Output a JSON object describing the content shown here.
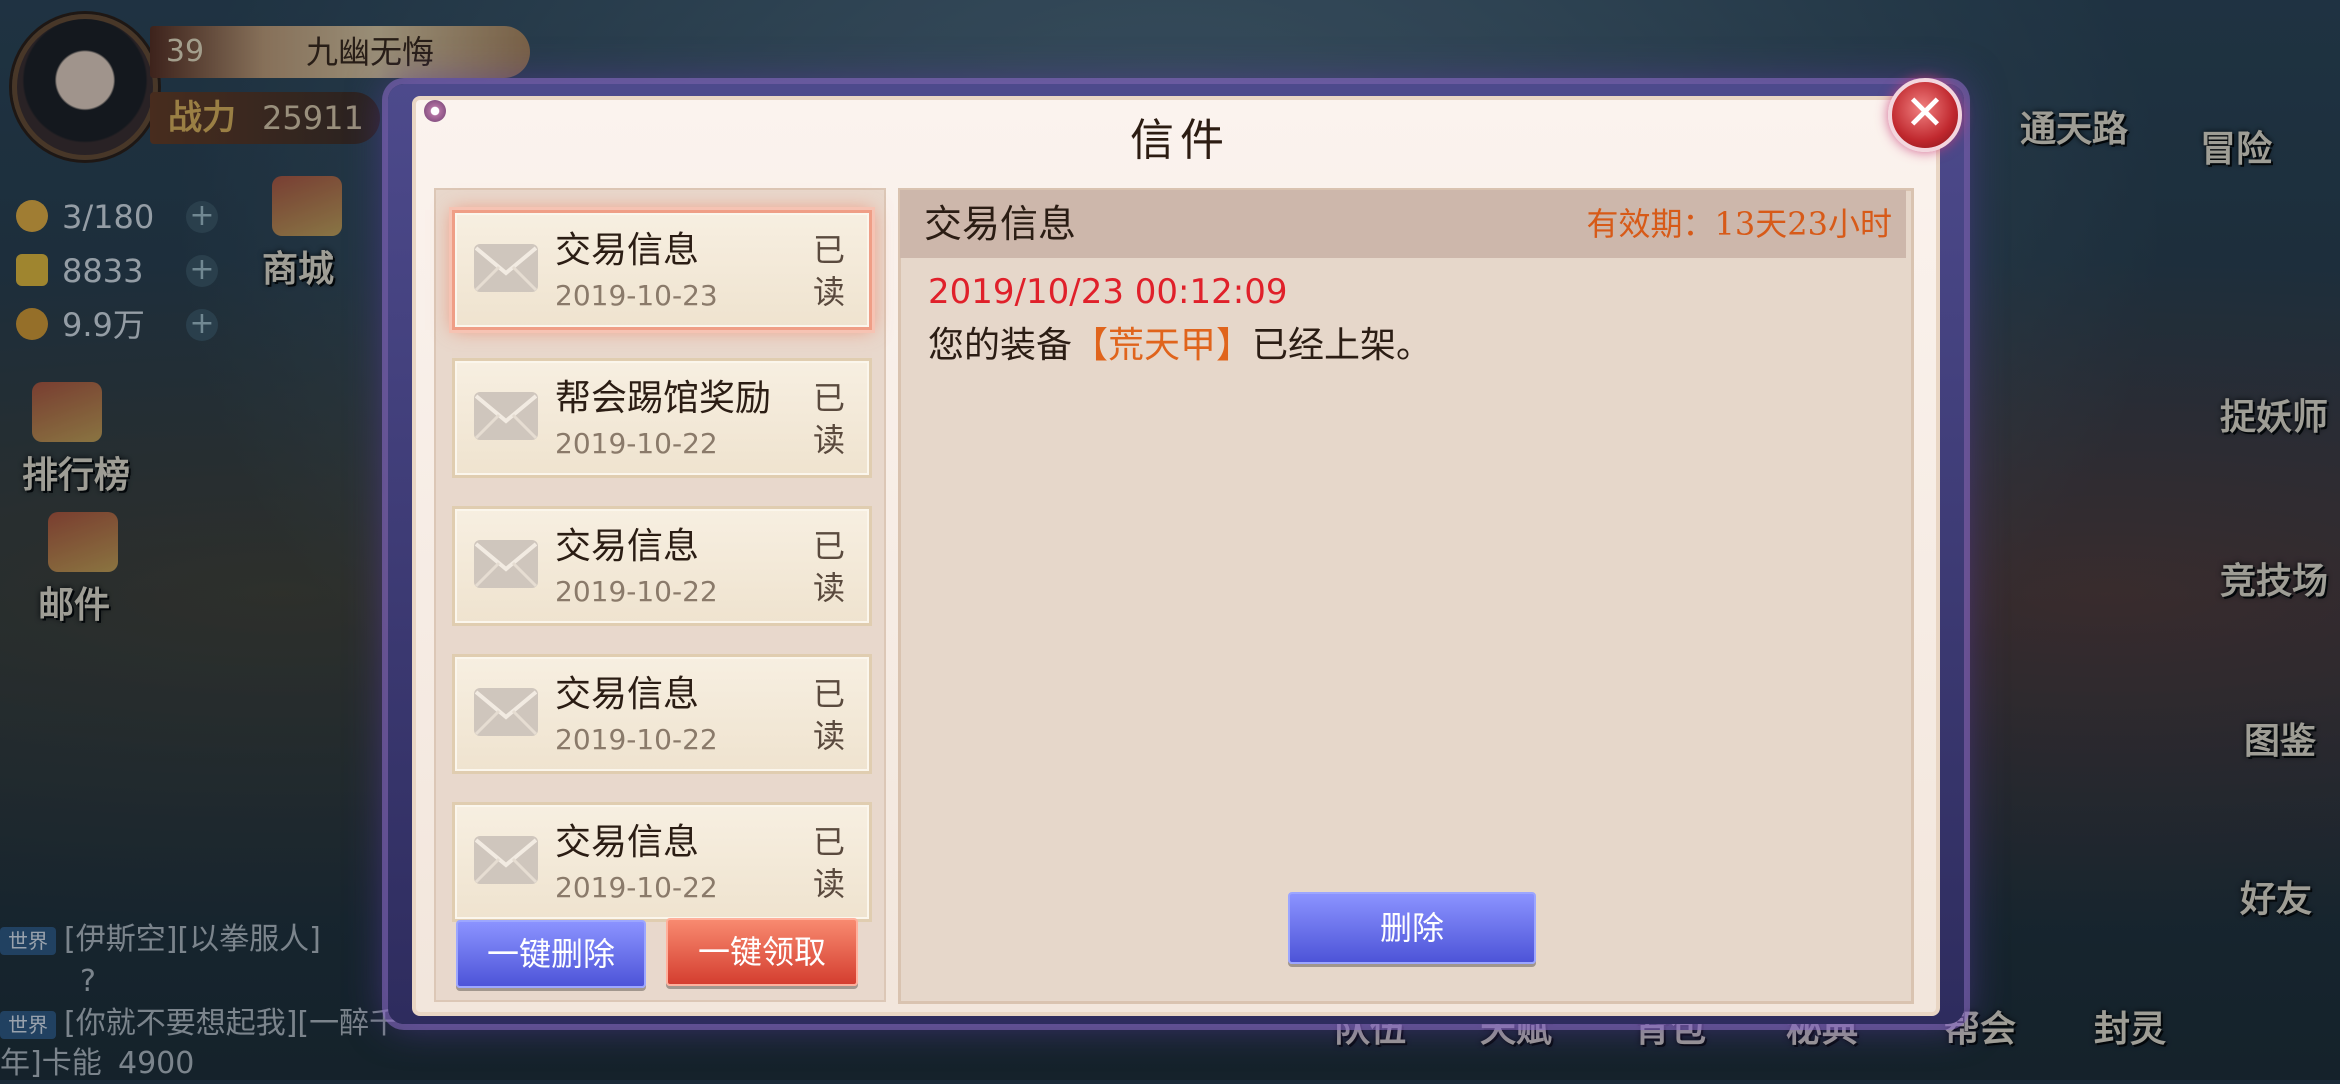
{
  "player": {
    "level": "39",
    "name": "九幽无悔",
    "power_label": "战力",
    "power_value": "25911"
  },
  "resources": [
    {
      "icon": "lightning-icon",
      "value": "3/180",
      "color": "#f2b640"
    },
    {
      "icon": "gold-ingot-icon",
      "value": "8833",
      "color": "#f0c23a"
    },
    {
      "icon": "coin-icon",
      "value": "9.9万",
      "color": "#e0a030"
    }
  ],
  "left_menu": {
    "shop": "商城",
    "ranking": "排行榜",
    "mail": "邮件"
  },
  "chat": [
    {
      "channel": "世界",
      "text": "[伊斯空][以拳服人]"
    },
    {
      "channel": "",
      "text": "?"
    },
    {
      "channel": "世界",
      "text": "[你就不要想起我][一醉千年]卡能"
    },
    {
      "channel": "",
      "text": "4900"
    }
  ],
  "right_menu": {
    "tongtian": "通天路",
    "adventure": "冒险",
    "demon_hunter": "捉妖师",
    "arena": "竞技场",
    "codex": "图鉴",
    "friends": "好友"
  },
  "bottom_menu": [
    "队伍",
    "天赋",
    "背包",
    "秘典",
    "帮会",
    "封灵"
  ],
  "dialog": {
    "title": "信件",
    "close": "✕",
    "mails": [
      {
        "title": "交易信息",
        "date": "2019-10-23",
        "status_line1": "已",
        "status_line2": "读"
      },
      {
        "title": "帮会踢馆奖励",
        "date": "2019-10-22",
        "status_line1": "已",
        "status_line2": "读"
      },
      {
        "title": "交易信息",
        "date": "2019-10-22",
        "status_line1": "已",
        "status_line2": "读"
      },
      {
        "title": "交易信息",
        "date": "2019-10-22",
        "status_line1": "已",
        "status_line2": "读"
      },
      {
        "title": "交易信息",
        "date": "2019-10-22",
        "status_line1": "已",
        "status_line2": "读"
      }
    ],
    "delete_all": "一键删除",
    "claim_all": "一键领取",
    "detail": {
      "title": "交易信息",
      "expiry": "有效期：13天23小时",
      "timestamp": "2019/10/23 00:12:09",
      "body_prefix": "您的装备",
      "body_item": "【荒天甲】",
      "body_suffix": "已经上架。",
      "delete_button": "删除"
    }
  },
  "colors": {
    "accent_red": "#e0202a",
    "highlight_orange": "#e0641c",
    "button_blue": "#4d54d8",
    "button_red": "#d43e30"
  }
}
